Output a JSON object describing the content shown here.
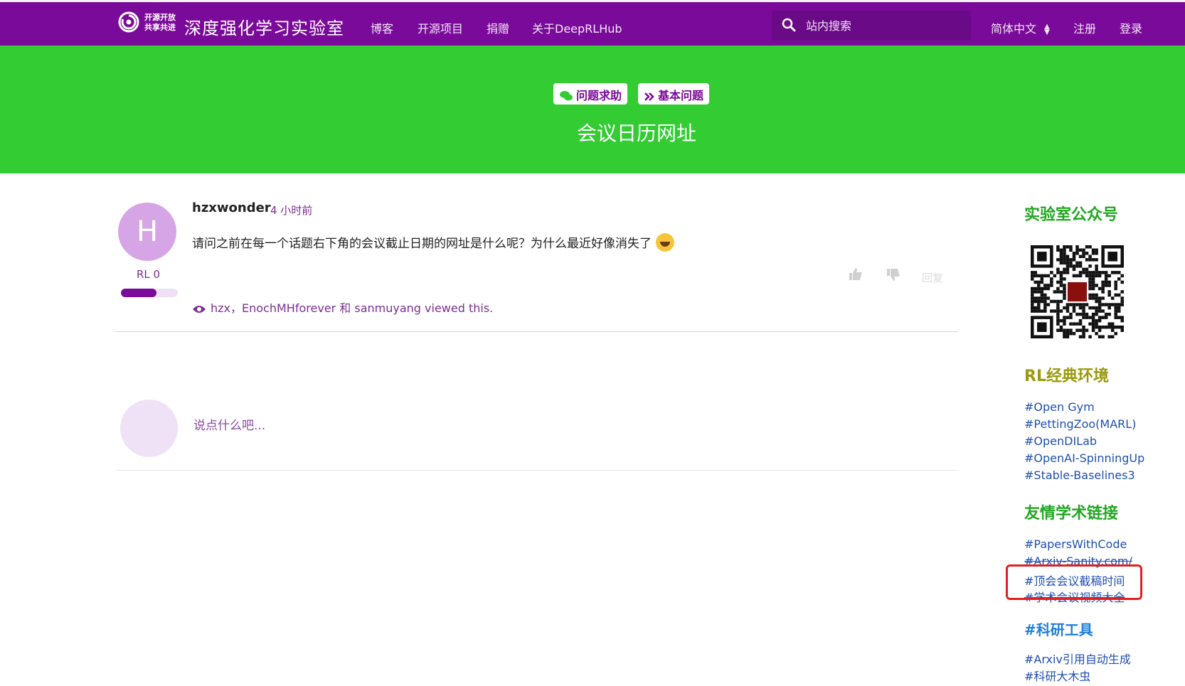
{
  "header": {
    "logo_line1": "开源开放",
    "logo_line2": "共享共进",
    "brand": "深度强化学习实验室",
    "nav": [
      "博客",
      "开源项目",
      "捐赠",
      "关于DeepRLHub"
    ],
    "search_placeholder": "站内搜索",
    "language": "简体中文",
    "register": "注册",
    "login": "登录"
  },
  "banner": {
    "tags": [
      "问题求助",
      "基本问题"
    ],
    "title": "会议日历网址"
  },
  "post": {
    "avatar_letter": "H",
    "reputation_label": "RL 0",
    "reputation_fraction": 0.62,
    "author": "hzxwonder",
    "time": "4 小时前",
    "content": "请问之前在每一个话题右下角的会议截止日期的网址是什么呢？为什么最近好像消失了",
    "reply_label": "回复",
    "viewed_by": "hzx，EnochMHforever 和 sanmuyang viewed this."
  },
  "reply": {
    "placeholder": "说点什么吧..."
  },
  "sidebar": {
    "section1": {
      "title": "实验室公众号",
      "color": "#22a722"
    },
    "section2": {
      "title": "RL经典环境",
      "color": "#9a9a10",
      "links": [
        "#Open Gym",
        "#PettingZoo(MARL)",
        "#OpenDILab",
        "#OpenAI-SpinningUp",
        "#Stable-Baselines3"
      ]
    },
    "section3": {
      "title": "友情学术链接",
      "color": "#22a722",
      "links": [
        "#PapersWithCode",
        "#Arxiv-Sanity.com/",
        "#顶会会议截稿时间",
        "#学术会议视频大全"
      ]
    },
    "section4": {
      "title": "#科研工具",
      "color": "#1e7fd8",
      "links": [
        "#Arxiv引用自动生成",
        "#科研大木虫"
      ]
    }
  },
  "colors": {
    "header": "#7a0a99",
    "banner": "#33cc33",
    "accent": "#7a0a99",
    "highlight": "#e02020"
  }
}
